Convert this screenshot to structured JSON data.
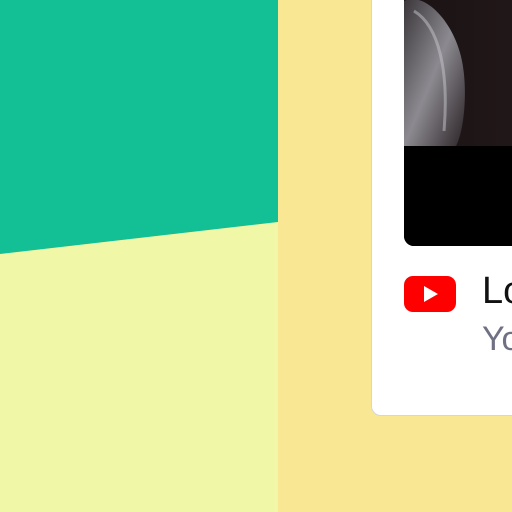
{
  "embed_card": {
    "title": "Lo",
    "subtitle": "Yo",
    "icon": "youtube-play-icon"
  },
  "colors": {
    "page_background": "#f9e793",
    "panel_light": "#f0f7a7",
    "panel_teal": "#13bf94",
    "card_background": "#ffffff",
    "thumbnail_background": "#000000",
    "youtube_red": "#ff0000",
    "title_text": "#111111",
    "subtitle_text": "#707085"
  }
}
